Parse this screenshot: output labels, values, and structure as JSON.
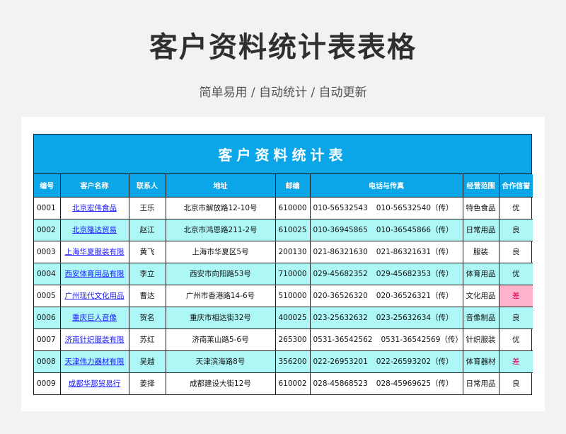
{
  "header": {
    "title": "客户资料统计表表格",
    "subtitle": "简单易用 / 自动统计 / 自动更新"
  },
  "sheet": {
    "title": "客户资料统计表",
    "columns": [
      "编号",
      "客户名称",
      "联系人",
      "地址",
      "邮编",
      "电话与传真",
      "经营范围",
      "合作信誉"
    ],
    "rows": [
      {
        "id": "0001",
        "name": "北京宏伟食品",
        "contact": "王乐",
        "address": "北京市解放路12-10号",
        "zip": "610000",
        "phone": "010-56532543",
        "fax": "010-56532540（传）",
        "scope": "特色食品",
        "credit": "优"
      },
      {
        "id": "0002",
        "name": "北京隆达贸易",
        "contact": "赵江",
        "address": "北京市鸿恩路211-2号",
        "zip": "610025",
        "phone": "010-36945865",
        "fax": "010-36545866（传）",
        "scope": "日常用品",
        "credit": "良"
      },
      {
        "id": "0003",
        "name": "上海华夏服装有限",
        "contact": "黄飞",
        "address": "上海市华夏区5号",
        "zip": "200130",
        "phone": "021-86321630",
        "fax": "021-86321631（传）",
        "scope": "服装",
        "credit": "良"
      },
      {
        "id": "0004",
        "name": "西安体育用品有限",
        "contact": "李立",
        "address": "西安市向阳路53号",
        "zip": "710000",
        "phone": "029-45682352",
        "fax": "029-45682353（传）",
        "scope": "体育用品",
        "credit": "优"
      },
      {
        "id": "0005",
        "name": "广州现代文化用品",
        "contact": "曹达",
        "address": "广州市香港路14-6号",
        "zip": "510000",
        "phone": "020-36526320",
        "fax": "020-36526321（传）",
        "scope": "文化用品",
        "credit": "差"
      },
      {
        "id": "0006",
        "name": "重庆巨人音像",
        "contact": "贺名",
        "address": "重庆市相达街32号",
        "zip": "400025",
        "phone": "023-25632632",
        "fax": "023-25632634（传）",
        "scope": "音像制品",
        "credit": "良"
      },
      {
        "id": "0007",
        "name": "济南针织服装有限",
        "contact": "苏红",
        "address": "济南莱山路5-6号",
        "zip": "265300",
        "phone": "0531-36542562",
        "fax": "0531-36542569（传）",
        "scope": "针织服装",
        "credit": "优"
      },
      {
        "id": "0008",
        "name": "天津伟力器材有限",
        "contact": "吴越",
        "address": "天津滨海路8号",
        "zip": "356200",
        "phone": "022-26953201",
        "fax": "022-26593202（传）",
        "scope": "体育器材",
        "credit": "差"
      },
      {
        "id": "0009",
        "name": "成都华那贸易行",
        "contact": "姜择",
        "address": "成都建设大街12号",
        "zip": "610002",
        "phone": "028-45868523",
        "fax": "028-45969625（传）",
        "scope": "日常用品",
        "credit": "良"
      }
    ]
  },
  "colors": {
    "header_blue": "#0aa6e8",
    "stripe_cyan": "#aef7f7",
    "bad_pink": "#ffb3cc"
  }
}
